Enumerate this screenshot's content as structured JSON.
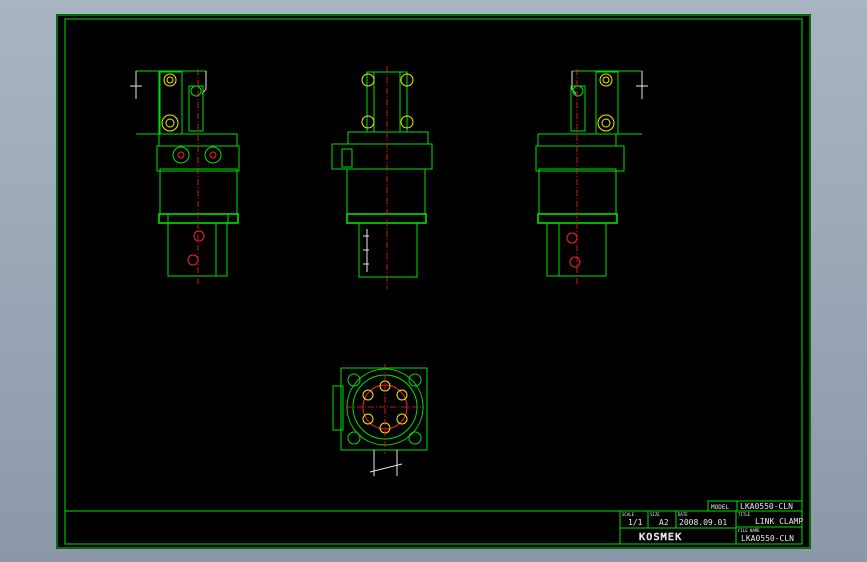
{
  "title_block": {
    "model_label": "MODEL",
    "model_value": "LKA0550-CLN",
    "title_label": "TITLE",
    "title_value": "LINK CLAMP",
    "scale_label": "SCALE",
    "scale_value": "1/1",
    "size_label": "SIZE",
    "size_value": "A2",
    "date_label": "DATE",
    "date_value": "2008.09.01",
    "file_label": "FILE NAME",
    "file_value": "LKA0550-CLN",
    "company_logo": "KOSMEK"
  },
  "colors": {
    "outline": "#00e000",
    "centerline": "#ff2020",
    "detail": "#f0f000",
    "text": "#e8e8e8",
    "background": "#000000"
  }
}
